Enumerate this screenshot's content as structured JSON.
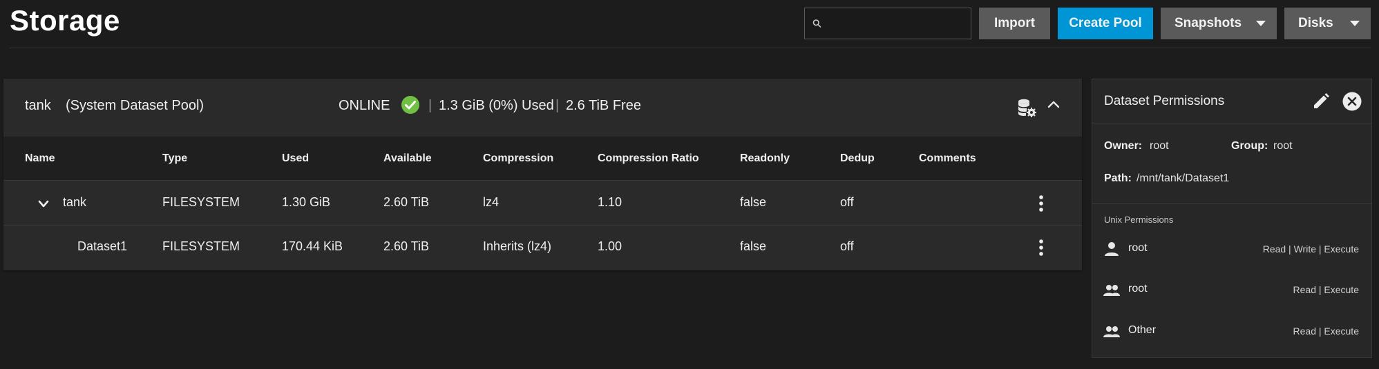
{
  "header": {
    "title": "Storage",
    "search_placeholder": "",
    "buttons": {
      "import": "Import",
      "create_pool": "Create Pool",
      "snapshots": "Snapshots",
      "disks": "Disks"
    }
  },
  "pool": {
    "name": "tank",
    "system_dataset": "(System Dataset Pool)",
    "status": "ONLINE",
    "separator": "|",
    "used": "1.3 GiB (0%) Used",
    "free": "2.6 TiB Free",
    "columns": [
      "Name",
      "Type",
      "Used",
      "Available",
      "Compression",
      "Compression Ratio",
      "Readonly",
      "Dedup",
      "Comments"
    ],
    "rows": [
      {
        "name": "tank",
        "type": "FILESYSTEM",
        "used": "1.30 GiB",
        "available": "2.60 TiB",
        "compression": "lz4",
        "ratio": "1.10",
        "readonly": "false",
        "dedup": "off",
        "comments": ""
      },
      {
        "name": "Dataset1",
        "type": "FILESYSTEM",
        "used": "170.44 KiB",
        "available": "2.60 TiB",
        "compression": "Inherits (lz4)",
        "ratio": "1.00",
        "readonly": "false",
        "dedup": "off",
        "comments": ""
      }
    ]
  },
  "permissions": {
    "title": "Dataset Permissions",
    "owner_label": "Owner:",
    "owner": "root",
    "group_label": "Group:",
    "group": "root",
    "path_label": "Path:",
    "path": "/mnt/tank/Dataset1",
    "unix_title": "Unix Permissions",
    "entries": [
      {
        "icon": "user-icon",
        "name": "root",
        "rights": "Read | Write | Execute"
      },
      {
        "icon": "group-icon",
        "name": "root",
        "rights": "Read | Execute"
      },
      {
        "icon": "group-icon",
        "name": "Other",
        "rights": "Read | Execute"
      }
    ]
  },
  "colors": {
    "background": "#1c1c1c",
    "card": "#2a2a2a",
    "primary_button": "#0095d5",
    "secondary_button": "#5a5a5a",
    "status_ok": "#71bf44"
  }
}
